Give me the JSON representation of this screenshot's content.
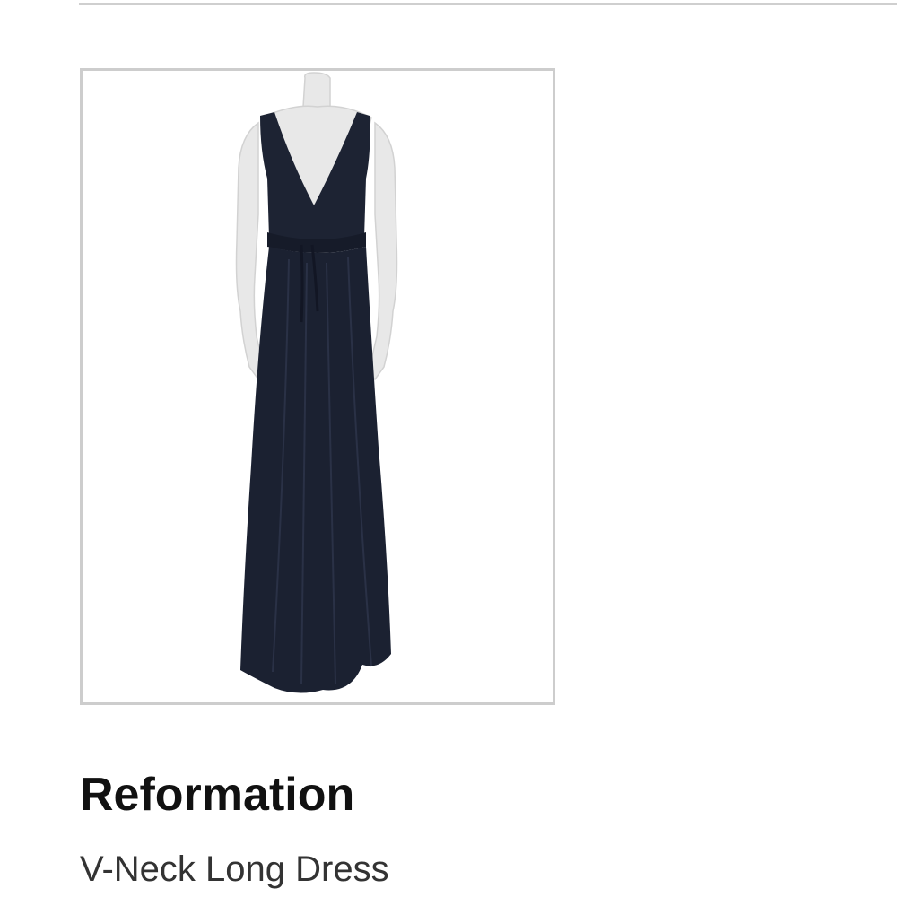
{
  "product": {
    "brand": "Reformation",
    "name": "V-Neck Long Dress",
    "image_subject": "navy v-neck long dress on mannequin",
    "colors": {
      "dress": "#1c2232",
      "mannequin": "#e6e6e6",
      "card_border": "#cdcdcd",
      "divider": "#cfcfcf"
    }
  }
}
